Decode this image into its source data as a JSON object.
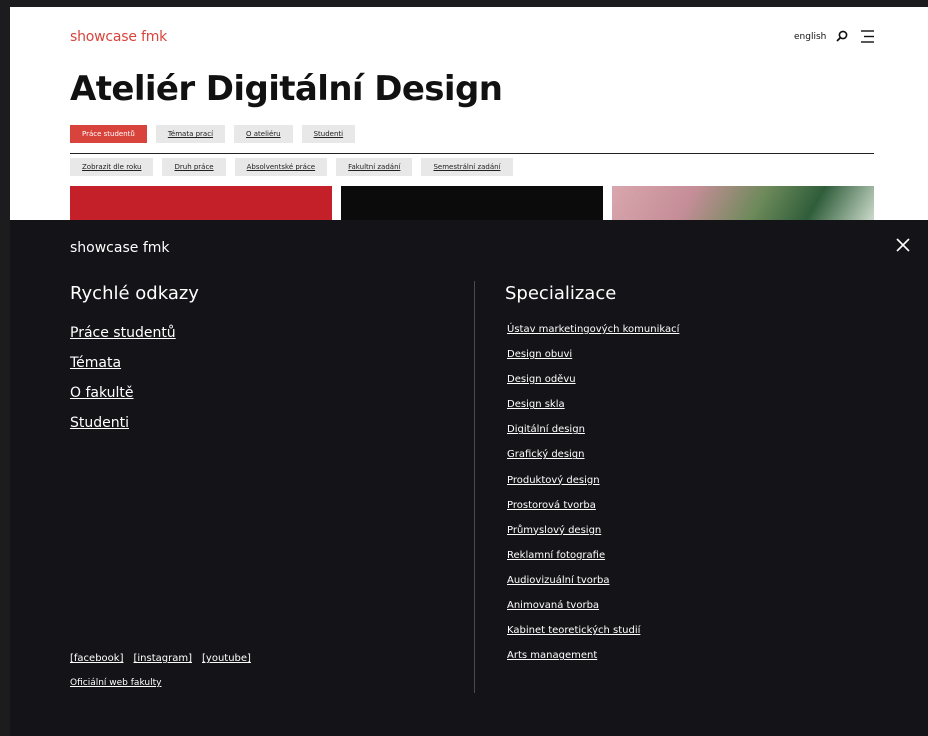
{
  "site": {
    "logo": "showcase fmk",
    "language": "english",
    "title": "Ateliér Digitální Design"
  },
  "tabs": [
    {
      "label": "Práce studentů",
      "active": true
    },
    {
      "label": "Témata prací",
      "active": false
    },
    {
      "label": "O ateliéru",
      "active": false
    },
    {
      "label": "Studenti",
      "active": false
    }
  ],
  "filters": [
    "Zobrazit dle roku",
    "Druh práce",
    "Absolventské práce",
    "Fakultní zadání",
    "Semestrální zadání"
  ],
  "menu": {
    "logo": "showcase fmk",
    "quick_title": "Rychlé odkazy",
    "quick_links": [
      "Práce studentů",
      "Témata",
      "O fakultě",
      "Studenti"
    ],
    "spec_title": "Specializace",
    "specializations": [
      "Ústav marketingových komunikací",
      "Design obuvi",
      "Design oděvu",
      "Design skla",
      "Digitální design",
      "Grafický design",
      "Produktový design",
      "Prostorová tvorba",
      "Průmyslový design",
      "Reklamní fotografie",
      "Audiovizuální tvorba",
      "Animovaná tvorba",
      "Kabinet teoretických studií",
      "Arts management"
    ],
    "social": [
      "[facebook]",
      "[instagram]",
      "[youtube]"
    ],
    "official": "Oficiální web fakulty"
  },
  "colors": {
    "accent": "#d8443b",
    "overlay_bg": "#141317",
    "page_bg": "#ffffff"
  },
  "icons": {
    "search": "search-icon",
    "menu": "menu-icon",
    "close": "close-icon"
  }
}
